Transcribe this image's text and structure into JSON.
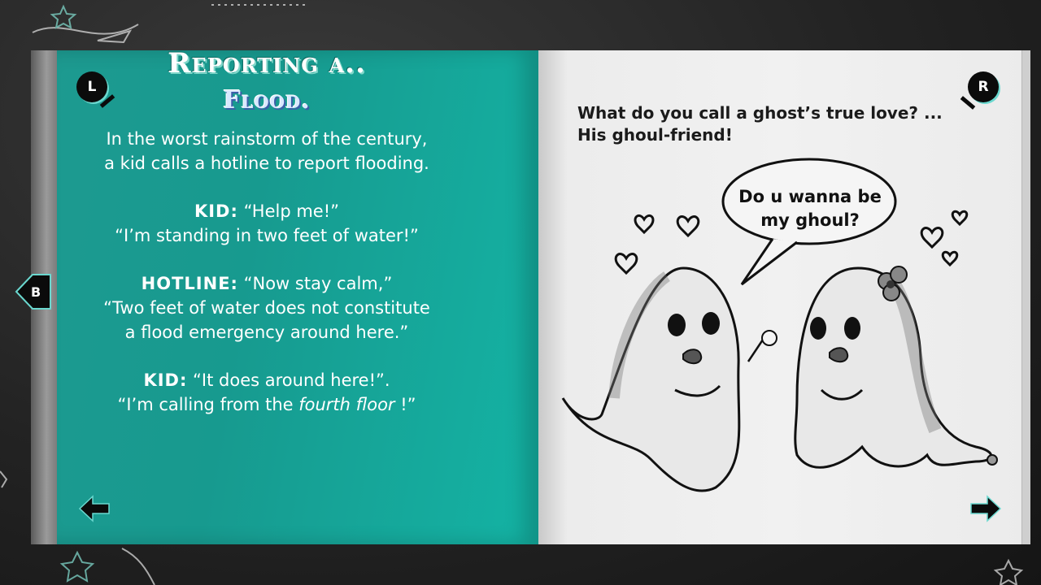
{
  "controls": {
    "left_button": "L",
    "right_button": "R",
    "back_button": "B"
  },
  "left_page": {
    "title_line1": "Reporting a..",
    "title_line2": "Flood.",
    "para1_line1": "In the worst rainstorm of the century,",
    "para1_line2": "a kid calls a hotline to report flooding.",
    "para2_speaker": "KID:",
    "para2_line1": "“Help me!”",
    "para2_line2": "“I’m standing in two feet of water!”",
    "para3_speaker": "HOTLINE:",
    "para3_line1": "“Now stay calm,”",
    "para3_line2": "“Two feet of water does not constitute",
    "para3_line3": "a flood emergency around here.”",
    "para4_speaker": "KID:",
    "para4_line1": "“It does around here!”.",
    "para4_line2_start": "“I’m calling from the ",
    "para4_line2_italic": "fourth floor",
    "para4_line2_end": " !”"
  },
  "right_page": {
    "question_line1": "What do you call a ghost’s true love? ...",
    "question_line2": "His ghoul-friend!",
    "bubble_line1": "Do u wanna be",
    "bubble_line2": "my ghoul?"
  },
  "icons": {
    "prev": "arrow-left-icon",
    "next": "arrow-right-icon",
    "back": "back-tab-icon"
  },
  "colors": {
    "left_page": "#179a8f",
    "right_page": "#efefef",
    "accent": "#6ad8cf",
    "background": "#1f1f1f"
  }
}
